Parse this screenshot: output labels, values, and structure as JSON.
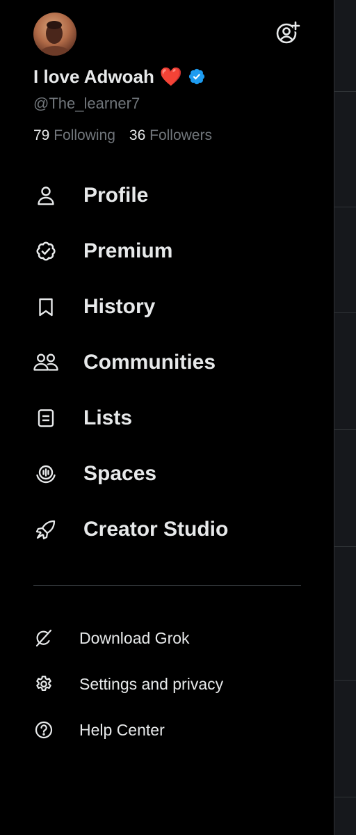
{
  "profile": {
    "display_name": "I love Adwoah",
    "heart_emoji": "❤️",
    "handle": "@The_learner7",
    "following_count": "79",
    "following_label": "Following",
    "followers_count": "36",
    "followers_label": "Followers",
    "verified": true
  },
  "nav": {
    "items": [
      {
        "label": "Profile",
        "icon": "person-icon"
      },
      {
        "label": "Premium",
        "icon": "premium-badge-icon"
      },
      {
        "label": "History",
        "icon": "bookmark-icon"
      },
      {
        "label": "Communities",
        "icon": "communities-icon"
      },
      {
        "label": "Lists",
        "icon": "lists-icon"
      },
      {
        "label": "Spaces",
        "icon": "spaces-icon"
      },
      {
        "label": "Creator Studio",
        "icon": "rocket-icon"
      }
    ]
  },
  "secondary": {
    "items": [
      {
        "label": "Download Grok",
        "icon": "grok-icon"
      },
      {
        "label": "Settings and privacy",
        "icon": "gear-icon"
      },
      {
        "label": "Help Center",
        "icon": "help-icon"
      }
    ]
  },
  "colors": {
    "background": "#000000",
    "text_primary": "#e7e9ea",
    "text_secondary": "#71767b",
    "verified_blue": "#1d9bf0",
    "divider": "#2f3336"
  }
}
